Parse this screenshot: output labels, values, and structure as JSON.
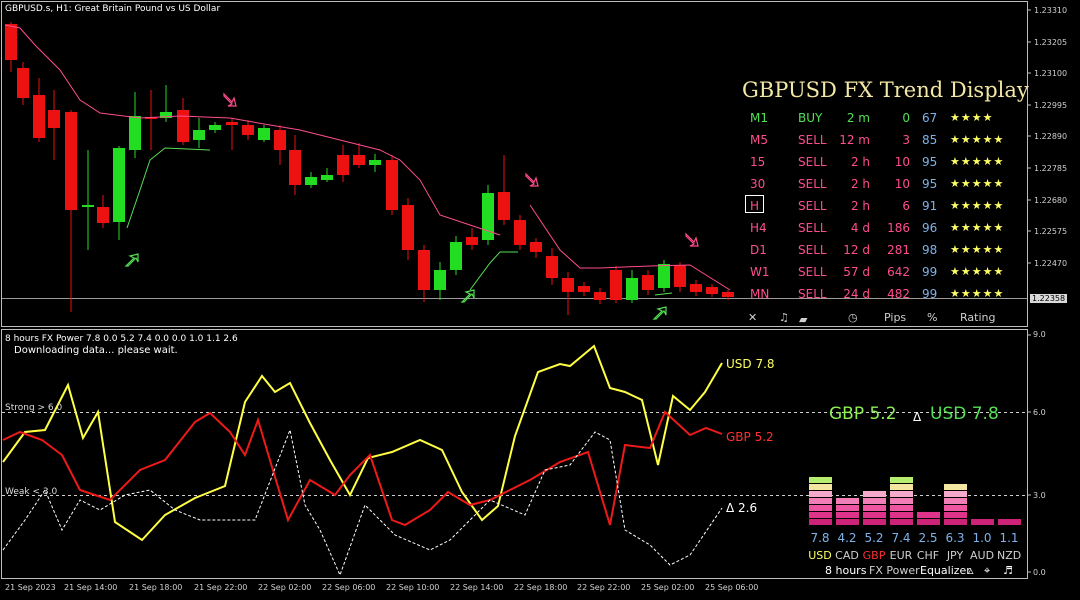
{
  "header": {
    "title": "GBPUSD.s, H1:  Great Britain Pound vs US Dollar",
    "indicator_label": "8 hours FX Power 7.8 0.0 5.2 7.4 0.0 0.0 1.0 1.1 2.6",
    "status": "Downloading data... please wait."
  },
  "price_axis": {
    "ticks": [
      "1.23310",
      "1.23205",
      "1.23100",
      "1.22995",
      "1.22890",
      "1.22785",
      "1.22680",
      "1.22575",
      "1.22470",
      "1.22358"
    ],
    "current_price": "1.22358"
  },
  "power_axis": {
    "ticks": [
      "9.0",
      "6.0",
      "3.0",
      "0.0"
    ]
  },
  "time_axis": {
    "labels": [
      "21 Sep 2023",
      "21 Sep 14:00",
      "21 Sep 18:00",
      "21 Sep 22:00",
      "22 Sep 02:00",
      "22 Sep 06:00",
      "22 Sep 10:00",
      "22 Sep 14:00",
      "22 Sep 18:00",
      "22 Sep 22:00",
      "25 Sep 02:00",
      "25 Sep 06:00"
    ]
  },
  "trend_display": {
    "title": "GBPUSD FX Trend Display",
    "rows": [
      {
        "tf": "M1",
        "signal": "BUY",
        "age": "2 m",
        "pips": "0",
        "pct": "67",
        "stars": "★★★★"
      },
      {
        "tf": "M5",
        "signal": "SELL",
        "age": "12 m",
        "pips": "3",
        "pct": "85",
        "stars": "★★★★★"
      },
      {
        "tf": "15",
        "signal": "SELL",
        "age": "2 h",
        "pips": "10",
        "pct": "95",
        "stars": "★★★★★"
      },
      {
        "tf": "30",
        "signal": "SELL",
        "age": "2 h",
        "pips": "10",
        "pct": "95",
        "stars": "★★★★★"
      },
      {
        "tf": "H",
        "signal": "SELL",
        "age": "2 h",
        "pips": "6",
        "pct": "91",
        "stars": "★★★★★"
      },
      {
        "tf": "H4",
        "signal": "SELL",
        "age": "4 d",
        "pips": "186",
        "pct": "96",
        "stars": "★★★★★"
      },
      {
        "tf": "D1",
        "signal": "SELL",
        "age": "12 d",
        "pips": "281",
        "pct": "98",
        "stars": "★★★★★"
      },
      {
        "tf": "W1",
        "signal": "SELL",
        "age": "57 d",
        "pips": "642",
        "pct": "99",
        "stars": "★★★★★"
      },
      {
        "tf": "MN",
        "signal": "SELL",
        "age": "24 d",
        "pips": "482",
        "pct": "99",
        "stars": "★★★★★"
      }
    ],
    "footer": {
      "close": "✕",
      "music": "♫",
      "pips": "Pips",
      "pct": "%",
      "rating": "Rating"
    },
    "colors": {
      "buy": "#55e055",
      "sell": "#ff4d8f",
      "stars": "#ffff66"
    }
  },
  "power_panel": {
    "strong_label": "Strong > 6.0",
    "weak_label": "Weak < 3.0",
    "usd_label": "USD 7.8",
    "gbp_label": "GBP 5.2",
    "delta_label": "Δ 2.6",
    "headline_gbp": "GBP 5.2",
    "headline_delta": "Δ",
    "headline_usd": "USD 7.8",
    "currencies": [
      {
        "name": "USD",
        "value": "7.8",
        "level": 7.8
      },
      {
        "name": "CAD",
        "value": "4.2",
        "level": 4.2
      },
      {
        "name": "GBP",
        "value": "5.2",
        "level": 5.2
      },
      {
        "name": "EUR",
        "value": "7.4",
        "level": 7.4
      },
      {
        "name": "CHF",
        "value": "2.5",
        "level": 2.5
      },
      {
        "name": "JPY",
        "value": "6.3",
        "level": 6.3
      },
      {
        "name": "AUD",
        "value": "1.0",
        "level": 1.0
      },
      {
        "name": "NZD",
        "value": "1.1",
        "level": 1.1
      }
    ],
    "footer": {
      "period": "8 hours",
      "name": "FX Power",
      "equalizer": "Equalizer"
    }
  }
}
